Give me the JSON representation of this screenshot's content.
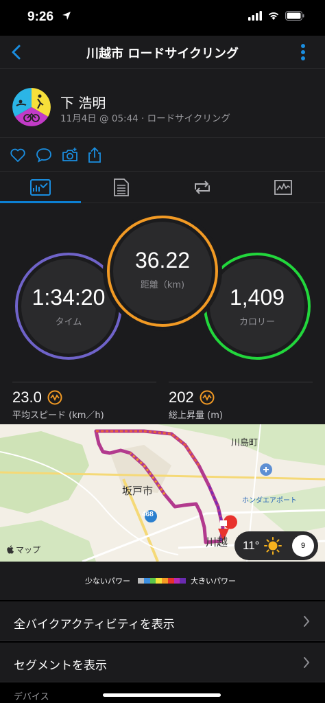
{
  "status_bar": {
    "time": "9:26"
  },
  "nav": {
    "title": "川越市 ロードサイクリング"
  },
  "header": {
    "name": "下 浩明",
    "subtitle": "11月4日 @ 05:44 · ロードサイクリング"
  },
  "tabs": [
    {
      "icon": "summary-chart-icon",
      "active": true
    },
    {
      "icon": "details-list-icon",
      "active": false
    },
    {
      "icon": "laps-icon",
      "active": false
    },
    {
      "icon": "graph-icon",
      "active": false
    }
  ],
  "stats": {
    "time": {
      "value": "1:34:20",
      "label": "タイム",
      "color": "#7d6ccf"
    },
    "distance": {
      "value": "36.22",
      "label": "距離（km)",
      "color": "#f29a24"
    },
    "calories": {
      "value": "1,409",
      "label": "カロリー",
      "color": "#22d73c"
    }
  },
  "metrics": {
    "avg_speed": {
      "value": "23.0",
      "label": "平均スピード (km／h)"
    },
    "elevation": {
      "value": "202",
      "label": "総上昇量 (m)"
    }
  },
  "map": {
    "attribution": "マップ",
    "labels": {
      "city1": "坂戸市",
      "town": "川島町",
      "airport": "ホンダエアポート",
      "city2": "川越",
      "route_number": "468"
    },
    "weather": {
      "temp": "11°",
      "wind": "9"
    }
  },
  "legend": {
    "min_label": "少ないパワー",
    "max_label": "大きいパワー",
    "colors": [
      "#bdbdbd",
      "#3c8fe0",
      "#5bc54a",
      "#f3e23a",
      "#f39a24",
      "#e8322d",
      "#b52bb5",
      "#6a2bb0"
    ]
  },
  "list": [
    {
      "label": "全バイクアクティビティを表示"
    },
    {
      "label": "セグメントを表示"
    }
  ],
  "section": {
    "label": "デバイス"
  }
}
